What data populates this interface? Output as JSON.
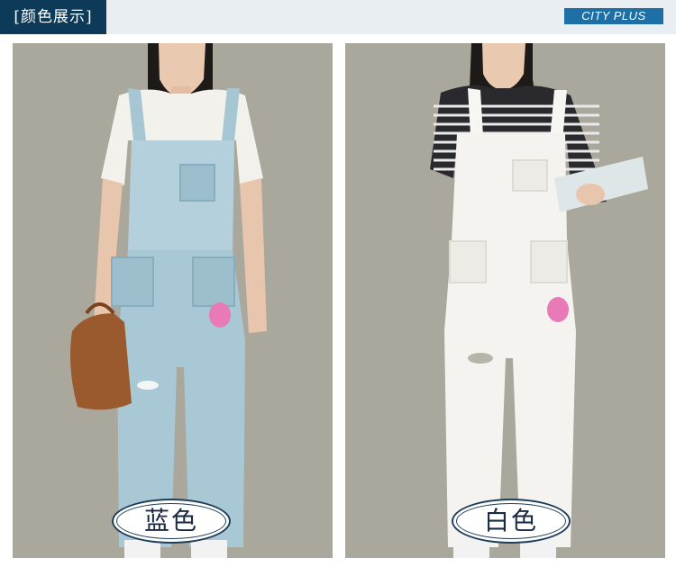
{
  "header": {
    "title": "[颜色展示]",
    "brand": "CITY PLUS",
    "colors": {
      "title_bg": "#0e3a5a",
      "brand_bg": "#1d6fa5",
      "bar_bg": "#e9eef2"
    }
  },
  "products": [
    {
      "label": "蓝色",
      "image": "model-in-light-blue-denim-overalls-white-tee-holding-brown-bag"
    },
    {
      "label": "白色",
      "image": "model-in-white-overalls-striped-tee-holding-magazine"
    }
  ]
}
